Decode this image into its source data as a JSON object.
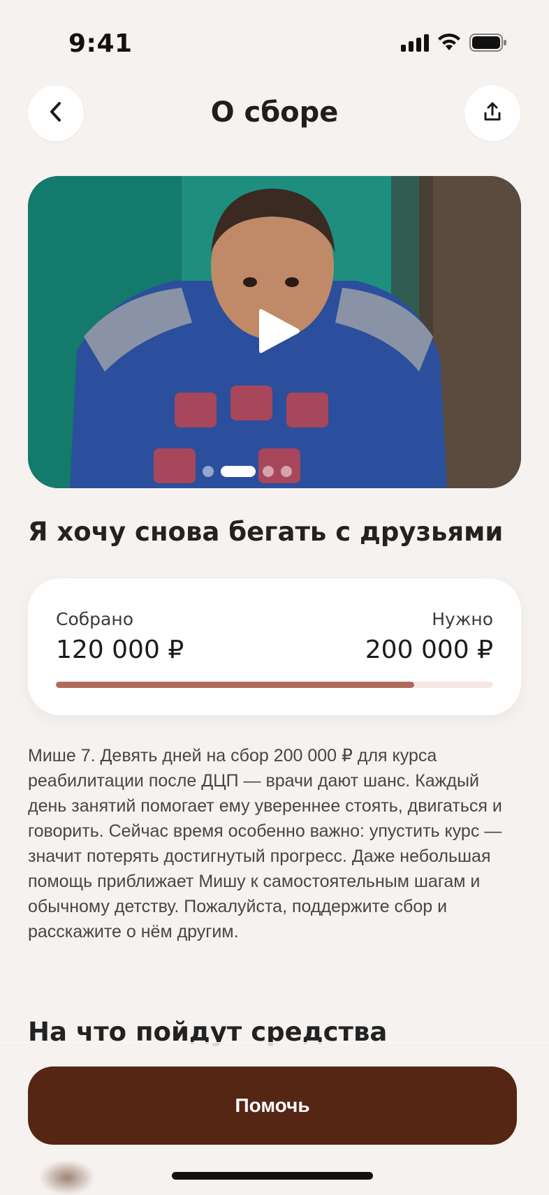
{
  "status_bar": {
    "time": "9:41",
    "icons": [
      "signal-icon",
      "wifi-icon",
      "battery-icon"
    ]
  },
  "header": {
    "title": "О сборе",
    "back_icon": "chevron-left-icon",
    "share_icon": "share-icon"
  },
  "media": {
    "play_icon": "play-icon",
    "slides_count": 4,
    "active_slide": 1
  },
  "fundraiser": {
    "headline": "Я хочу снова бегать с друзьями",
    "collected_label": "Собрано",
    "collected_value": "120 000 ₽",
    "needed_label": "Нужно",
    "needed_value": "200 000 ₽",
    "progress_fraction": 0.82,
    "accent_color": "#b06a5a",
    "track_color": "#f6e6e2"
  },
  "description": "Мише 7. Девять дней на сбор 200 000 ₽ для курса реабилитации после ДЦП — врачи дают шанс. Каждый день занятий помогает ему увереннее стоять, двигаться и говорить. Сейчас время особенно важно: упустить курс — значит потерять достигнутый прогресс. Даже небольшая помощь приближает Мишу к самостоятельным шагам и обычному детству. Пожалуйста, поддержите сбор и расскажите о нём другим.",
  "section": {
    "title": "На что пойдут средства"
  },
  "cta": {
    "label": "Помочь",
    "color": "#552614"
  }
}
